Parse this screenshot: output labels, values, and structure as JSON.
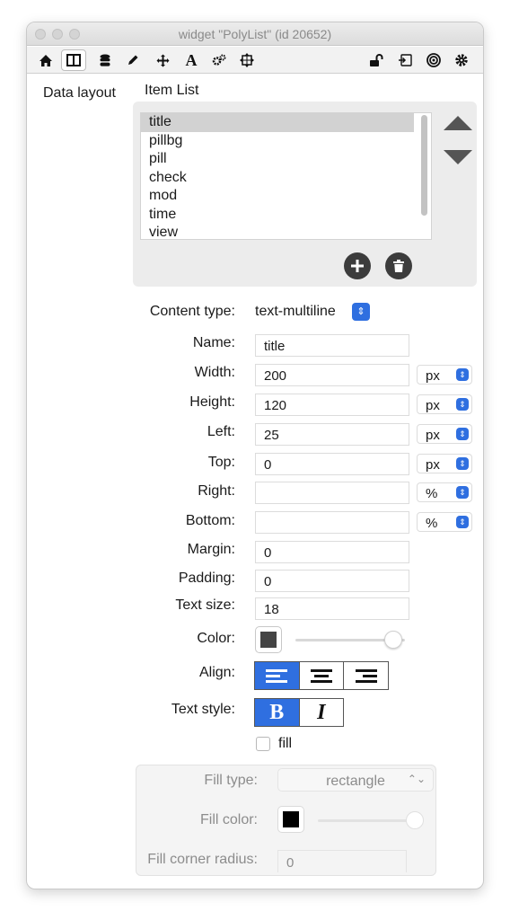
{
  "window": {
    "title": "widget \"PolyList\" (id 20652)"
  },
  "toolbar": {
    "left_icons": [
      "home-icon",
      "layout-icon",
      "database-icon",
      "pencil-icon",
      "move-icon",
      "text-icon",
      "gears-icon",
      "resize-icon"
    ],
    "right_icons": [
      "unlock-icon",
      "export-icon",
      "target-icon",
      "gear-icon"
    ],
    "active": "layout-icon"
  },
  "sidebar": {
    "label": "Data layout"
  },
  "item_list": {
    "title": "Item List",
    "items": [
      "title",
      "pillbg",
      "pill",
      "check",
      "mod",
      "time",
      "view"
    ],
    "selected": "title"
  },
  "form": {
    "content_type": {
      "label": "Content type:",
      "value": "text-multiline"
    },
    "name": {
      "label": "Name:",
      "value": "title"
    },
    "width": {
      "label": "Width:",
      "value": "200",
      "unit": "px"
    },
    "height": {
      "label": "Height:",
      "value": "120",
      "unit": "px"
    },
    "left": {
      "label": "Left:",
      "value": "25",
      "unit": "px"
    },
    "top": {
      "label": "Top:",
      "value": "0",
      "unit": "px"
    },
    "right": {
      "label": "Right:",
      "value": "",
      "unit": "%"
    },
    "bottom": {
      "label": "Bottom:",
      "value": "",
      "unit": "%"
    },
    "margin": {
      "label": "Margin:",
      "value": "0"
    },
    "padding": {
      "label": "Padding:",
      "value": "0"
    },
    "text_size": {
      "label": "Text size:",
      "value": "18"
    },
    "color": {
      "label": "Color:",
      "swatch": "#444444"
    },
    "align": {
      "label": "Align:",
      "selected": "left"
    },
    "text_style": {
      "label": "Text style:",
      "bold_glyph": "B",
      "italic_glyph": "I"
    },
    "fill_checkbox": {
      "label": "fill",
      "checked": false
    }
  },
  "fill": {
    "type": {
      "label": "Fill type:",
      "value": "rectangle"
    },
    "color": {
      "label": "Fill color:",
      "swatch": "#000000"
    },
    "corner_radius": {
      "label": "Fill corner radius:",
      "value": "0"
    }
  },
  "colors": {
    "accent": "#2f6fe0"
  }
}
